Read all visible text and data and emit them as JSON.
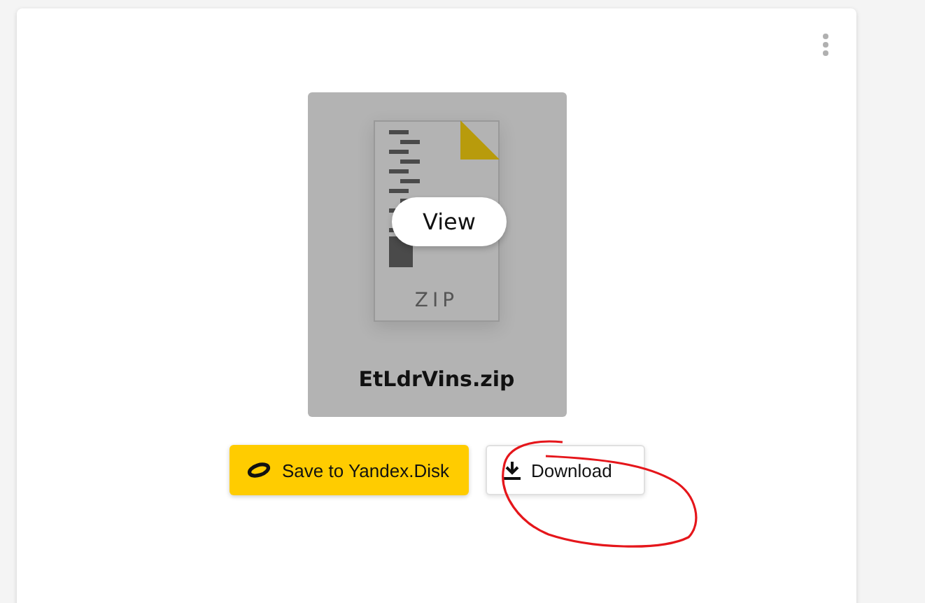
{
  "preview": {
    "file_type": "ZIP",
    "view_button": "View",
    "file_name": "EtLdrVins.zip"
  },
  "actions": [
    {
      "label": "Save to Yandex.Disk",
      "kind": "primary"
    },
    {
      "label": "Download",
      "kind": "secondary"
    }
  ]
}
